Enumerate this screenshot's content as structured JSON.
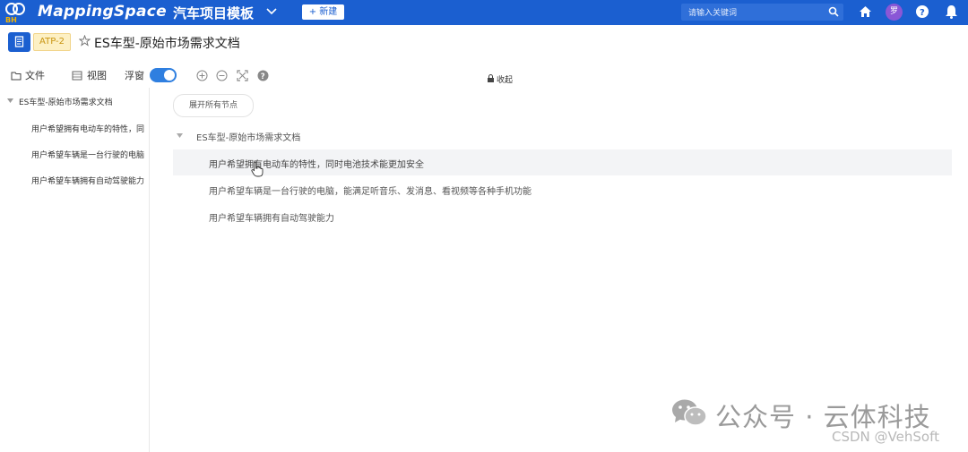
{
  "topbar": {
    "logo_text": "BH",
    "brand": "MappingSpace",
    "project_name": "汽车项目模板",
    "new_button_label": "+ 新建",
    "search_placeholder": "请输入关键词",
    "avatar_initial": "罗",
    "bar_color": "#1b5fd0"
  },
  "doc": {
    "id": "ATP-2",
    "title": "ES车型-原始市场需求文档"
  },
  "toolbar": {
    "file_label": "文件",
    "view_label": "视图",
    "float_label": "浮窗",
    "float_toggle_on": true,
    "collapse_label": "收起"
  },
  "sidebar": {
    "root": "ES车型-原始市场需求文档",
    "items": [
      "用户希望拥有电动车的特性，同",
      "用户希望车辆是一台行驶的电脑",
      "用户希望车辆拥有自动驾驶能力"
    ]
  },
  "main": {
    "expand_all_label": "展开所有节点",
    "root": "ES车型-原始市场需求文档",
    "rows": [
      "用户希望拥有电动车的特性，同时电池技术能更加安全",
      "用户希望车辆是一台行驶的电脑，能满足听音乐、发消息、看视频等各种手机功能",
      "用户希望车辆拥有自动驾驶能力"
    ]
  },
  "watermark": {
    "channel": "公众号 · 云体科技",
    "csdn": "CSDN @VehSoft"
  },
  "icons": [
    "logo-icon",
    "chevron-down-icon",
    "search-icon",
    "home-icon",
    "help-icon",
    "bell-icon",
    "document-icon",
    "star-icon",
    "folder-icon",
    "view-icon",
    "zoom-in-icon",
    "zoom-out-icon",
    "fit-screen-icon",
    "help-circle-icon",
    "lock-icon",
    "caret-down-icon",
    "cursor-icon",
    "wechat-icon"
  ]
}
